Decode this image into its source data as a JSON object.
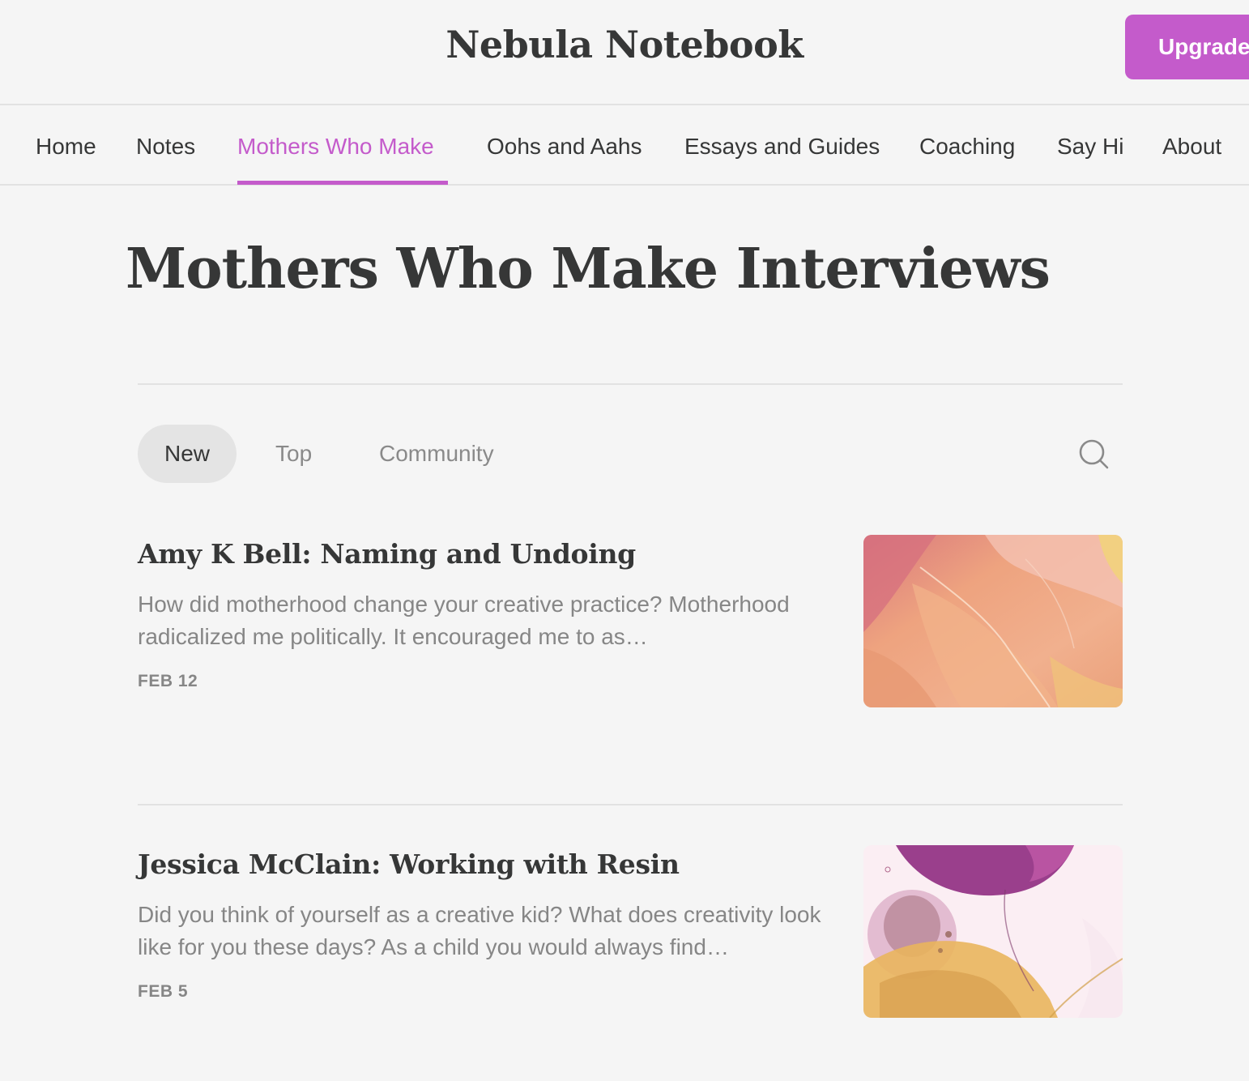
{
  "header": {
    "site_title": "Nebula Notebook",
    "upgrade_label": "Upgrade"
  },
  "nav": {
    "items": [
      {
        "label": "Home"
      },
      {
        "label": "Notes"
      },
      {
        "label": "Mothers Who Make",
        "active": true
      },
      {
        "label": "Oohs and Aahs"
      },
      {
        "label": "Essays and Guides"
      },
      {
        "label": "Coaching"
      },
      {
        "label": "Say Hi"
      },
      {
        "label": "About"
      }
    ]
  },
  "section": {
    "title": "Mothers Who Make Interviews"
  },
  "filters": {
    "tabs": [
      {
        "label": "New",
        "active": true
      },
      {
        "label": "Top"
      },
      {
        "label": "Community"
      }
    ],
    "search_icon": "search-icon"
  },
  "posts": [
    {
      "title": "Amy K Bell: Naming and Undoing",
      "excerpt": "How did motherhood change your creative practice? Motherhood radicalized me politically. It encouraged me to as…",
      "date": "FEB 12"
    },
    {
      "title": "Jessica McClain: Working with Resin",
      "excerpt": "Did you think of yourself as a creative kid? What does creativity look like for you these days? As a child you would always find…",
      "date": "FEB 5"
    }
  ],
  "colors": {
    "accent": "#c45bcb",
    "background": "#f5f5f5",
    "text": "#363737",
    "muted": "#868686",
    "divider": "#e2e2e2"
  }
}
